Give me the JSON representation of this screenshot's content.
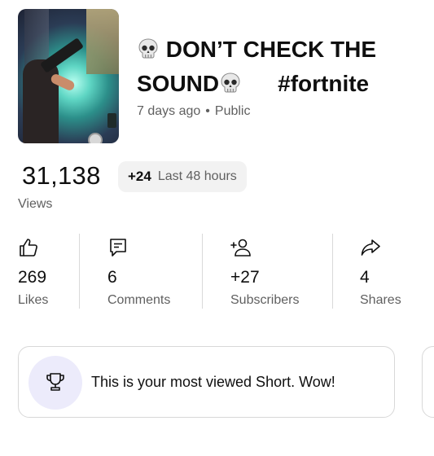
{
  "video": {
    "title_line1": "DON’T CHECK THE",
    "title_line2": "SOUND",
    "hashtag": "#fortnite",
    "age": "7 days ago",
    "separator": "•",
    "visibility": "Public"
  },
  "views": {
    "count": "31,138",
    "delta": "+24",
    "period": "Last 48 hours",
    "label": "Views"
  },
  "stats": [
    {
      "icon": "thumbs-up-icon",
      "value": "269",
      "label": "Likes"
    },
    {
      "icon": "comment-icon",
      "value": "6",
      "label": "Comments"
    },
    {
      "icon": "add-person-icon",
      "value": "+27",
      "label": "Subscribers"
    },
    {
      "icon": "share-icon",
      "value": "4",
      "label": "Shares"
    }
  ],
  "insight_card": {
    "icon": "trophy-icon",
    "message": "This is your most viewed Short. Wow!"
  },
  "colors": {
    "text": "#0f0f0f",
    "secondary": "#606060",
    "pill_bg": "#f2f2f2",
    "trophy_bg": "#ecebfb",
    "border": "#d8d8d8"
  }
}
